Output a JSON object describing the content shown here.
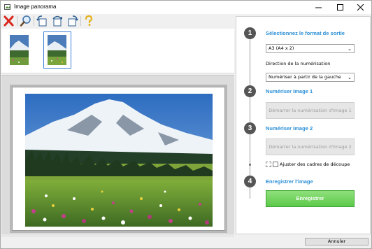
{
  "window": {
    "title": "Image panorama"
  },
  "toolbar": {
    "items": [
      "delete-icon",
      "zoom-icon",
      "rotate-left-icon",
      "rotate-180-icon",
      "rotate-right-icon",
      "help-icon"
    ]
  },
  "steps": [
    {
      "number": "1",
      "title": "Sélectionnez le format de sortie"
    },
    {
      "number": "2",
      "title": "Numériser Image 1"
    },
    {
      "number": "3",
      "title": "Numériser Image 2"
    },
    {
      "number": "4",
      "title": "Enregistrer l'image"
    }
  ],
  "output_format": {
    "selected": "A3 (A4 x 2)"
  },
  "scan_direction": {
    "label": "Direction de la numérisation",
    "selected": "Numériser à partir de la gauche"
  },
  "scan_buttons": {
    "image1": "Démarrer la numérisation d'Image 1",
    "image2": "Démarrer la numérisation d'Image 2"
  },
  "crop_frames": {
    "label": "Ajuster des cadres de découpe",
    "checked": false
  },
  "save_label": "Enregistrer",
  "cancel_label": "Annuler",
  "colors": {
    "accent": "#2b8fd6",
    "save": "#5cc94a",
    "step": "#555555"
  }
}
